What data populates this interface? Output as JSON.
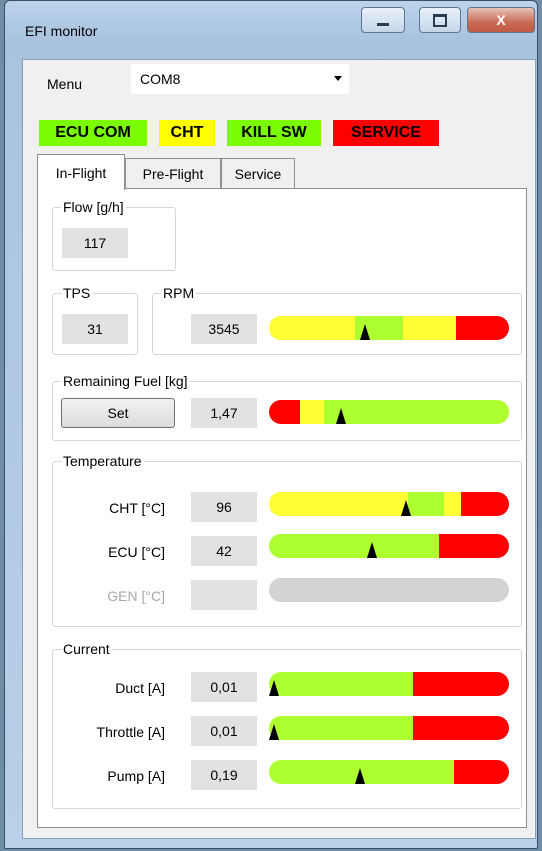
{
  "window": {
    "title": "EFI monitor",
    "close_glyph": "X"
  },
  "menu": {
    "label": "Menu",
    "port_value": "COM8"
  },
  "status": [
    {
      "label": "ECU COM",
      "color": "#7cfc00"
    },
    {
      "label": "CHT",
      "color": "#ffff00"
    },
    {
      "label": "KILL SW",
      "color": "#7cfc00"
    },
    {
      "label": "SERVICE",
      "color": "#ff0000"
    }
  ],
  "tabs": [
    {
      "label": "In-Flight",
      "active": true
    },
    {
      "label": "Pre-Flight",
      "active": false
    },
    {
      "label": "Service",
      "active": false
    }
  ],
  "colors": {
    "green": "#adff2f",
    "yellow": "#ffff33",
    "red": "#ff0000",
    "gray": "#d3d3d3"
  },
  "flow": {
    "label": "Flow [g/h]",
    "value": "117"
  },
  "tps": {
    "label": "TPS",
    "value": "31"
  },
  "rpm": {
    "label": "RPM",
    "value": "3545"
  },
  "fuel": {
    "label": "Remaining Fuel [kg]",
    "set_label": "Set",
    "value": "1,47"
  },
  "temperature": {
    "label": "Temperature",
    "rows": [
      {
        "label": "CHT [°C]",
        "value": "96",
        "enabled": true
      },
      {
        "label": "ECU [°C]",
        "value": "42",
        "enabled": true
      },
      {
        "label": "GEN [°C]",
        "value": "",
        "enabled": false
      }
    ]
  },
  "current": {
    "label": "Current",
    "rows": [
      {
        "label": "Duct [A]",
        "value": "0,01"
      },
      {
        "label": "Throttle [A]",
        "value": "0,01"
      },
      {
        "label": "Pump [A]",
        "value": "0,19"
      }
    ]
  },
  "gauges": {
    "rpm": {
      "segments": [
        [
          "yellow",
          0.36
        ],
        [
          "green",
          0.2
        ],
        [
          "yellow",
          0.22
        ],
        [
          "red",
          0.22
        ]
      ],
      "level": 0.4
    },
    "fuel": {
      "segments": [
        [
          "red",
          0.13
        ],
        [
          "yellow",
          0.1
        ],
        [
          "green",
          0.77
        ]
      ],
      "level": 0.3
    },
    "cht": {
      "segments": [
        [
          "yellow",
          0.58
        ],
        [
          "green",
          0.15
        ],
        [
          "yellow",
          0.07
        ],
        [
          "red",
          0.2
        ]
      ],
      "level": 0.57
    },
    "ecu": {
      "segments": [
        [
          "green",
          0.71
        ],
        [
          "red",
          0.29
        ]
      ],
      "level": 0.43
    },
    "gen": {
      "segments": [
        [
          "gray",
          1.0
        ]
      ],
      "level": null
    },
    "duct": {
      "segments": [
        [
          "green",
          0.6
        ],
        [
          "red",
          0.4
        ]
      ],
      "level": 0.02
    },
    "throttle": {
      "segments": [
        [
          "green",
          0.6
        ],
        [
          "red",
          0.4
        ]
      ],
      "level": 0.02
    },
    "pump": {
      "segments": [
        [
          "green",
          0.77
        ],
        [
          "red",
          0.23
        ]
      ],
      "level": 0.38
    }
  }
}
